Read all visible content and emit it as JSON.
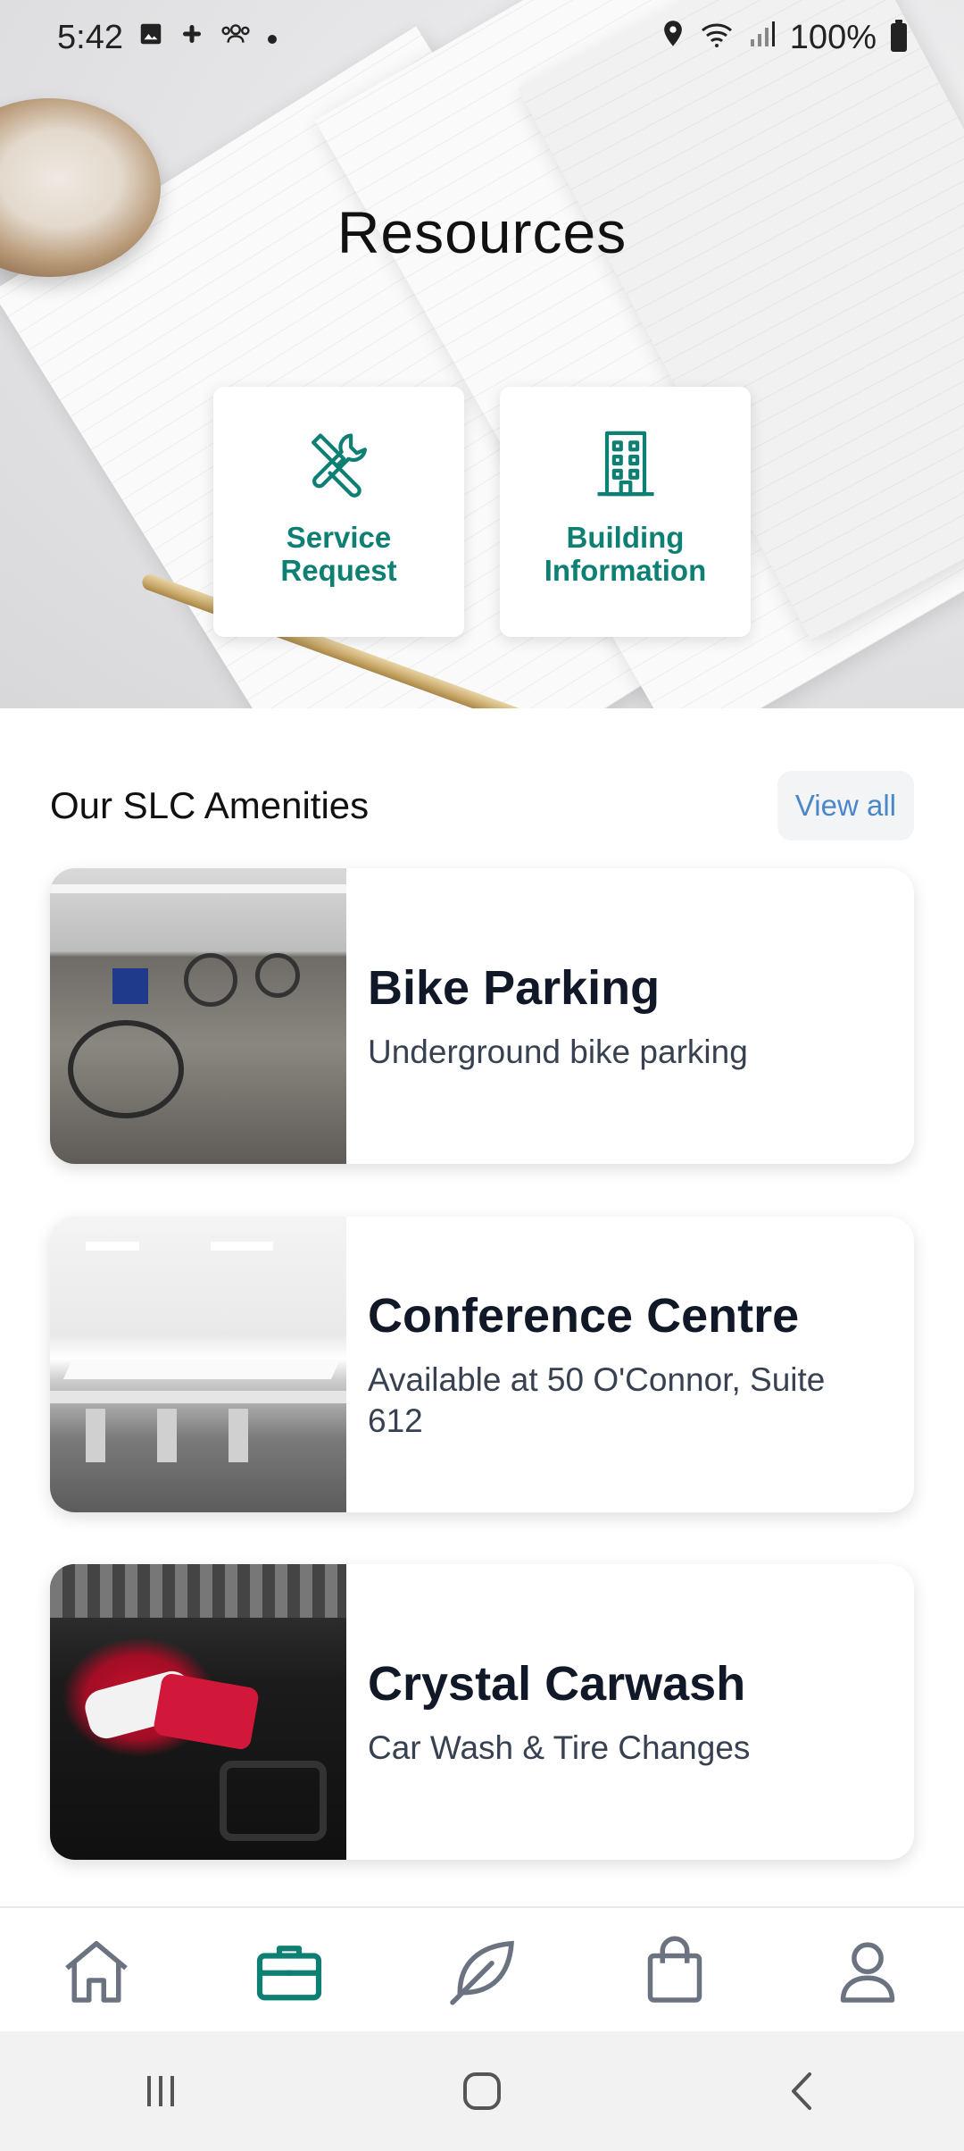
{
  "status": {
    "time": "5:42",
    "battery": "100%",
    "left_icons": [
      "gallery-icon",
      "slack-icon",
      "group-icon",
      "dot-icon"
    ],
    "right_icons": [
      "location-icon",
      "wifi-icon",
      "signal-icon",
      "battery-icon"
    ]
  },
  "hero": {
    "title": "Resources",
    "tiles": [
      {
        "label": "Service\nRequest",
        "icon": "tools-icon"
      },
      {
        "label": "Building\nInformation",
        "icon": "building-icon"
      }
    ]
  },
  "amenities": {
    "title": "Our SLC Amenities",
    "view_all": "View all",
    "items": [
      {
        "title": "Bike Parking",
        "subtitle": "Underground bike parking"
      },
      {
        "title": "Conference Centre",
        "subtitle": "Available at 50 O'Connor, Suite 612"
      },
      {
        "title": "Crystal Carwash",
        "subtitle": "Car Wash & Tire Changes"
      }
    ]
  },
  "bottom_nav": {
    "items": [
      "home-icon",
      "briefcase-icon",
      "leaf-icon",
      "bag-icon",
      "profile-icon"
    ],
    "active": "briefcase-icon"
  },
  "colors": {
    "accent": "#0e7f73",
    "link": "#4a86c8",
    "nav_inactive": "#6b7280"
  }
}
